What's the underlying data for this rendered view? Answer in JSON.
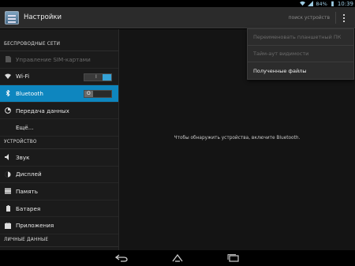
{
  "status_bar": {
    "battery": "84%",
    "time": "10:39"
  },
  "action_bar": {
    "title": "Настройки",
    "scan_button": "поиск устройств"
  },
  "sidebar": {
    "sections": [
      {
        "header": "БЕСПРОВОДНЫЕ СЕТИ"
      },
      {
        "header": "УСТРОЙСТВО"
      },
      {
        "header": "ЛИЧНЫЕ ДАННЫЕ"
      }
    ],
    "items": [
      {
        "label": "Управление SIM-картами",
        "icon": "sim-card-icon",
        "enabled": false
      },
      {
        "label": "Wi-Fi",
        "icon": "wifi-icon",
        "toggle": "on"
      },
      {
        "label": "Bluetooth",
        "icon": "bluetooth-icon",
        "toggle": "off",
        "toggle_label": "O",
        "selected": true
      },
      {
        "label": "Передача данных",
        "icon": "data-usage-icon"
      },
      {
        "label": "Ещё..."
      },
      {
        "label": "Звук",
        "icon": "volume-icon"
      },
      {
        "label": "Дисплей",
        "icon": "brightness-icon"
      },
      {
        "label": "Память",
        "icon": "storage-icon"
      },
      {
        "label": "Батарея",
        "icon": "battery-icon"
      },
      {
        "label": "Приложения",
        "icon": "apps-icon"
      }
    ]
  },
  "main": {
    "empty_message": "Чтобы обнаружить устройства, включите Bluetooth."
  },
  "overflow_menu": {
    "items": [
      {
        "label": "Переименовать планшетный ПК",
        "enabled": false
      },
      {
        "label": "Тайм-аут видимости",
        "enabled": false
      },
      {
        "label": "Полученные файлы",
        "enabled": true
      }
    ]
  },
  "colors": {
    "accent": "#0e86bf",
    "status_text": "#9ccbe2"
  }
}
